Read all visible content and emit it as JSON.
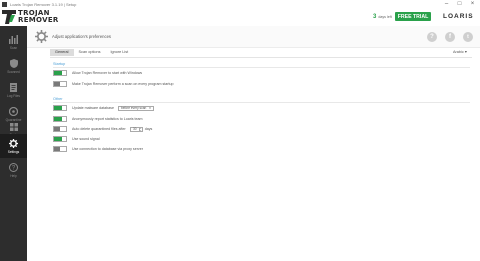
{
  "window": {
    "title": "Loaris Trojan Remover 3.1.19 | Setup"
  },
  "logo": {
    "line1": "TROJAN",
    "line2": "REMOVER"
  },
  "trial": {
    "days": "3",
    "days_left_label": "days left",
    "button": "FREE TRIAL"
  },
  "brand": "LOARIS",
  "header": {
    "subtitle": "Adjust application's preferences",
    "help": "?",
    "settings": "f"
  },
  "sidebar": {
    "items": [
      {
        "label": "Scan",
        "icon": "scan-icon"
      },
      {
        "label": "Scanned",
        "icon": "shield-icon"
      },
      {
        "label": "Log Files",
        "icon": "logfiles-icon"
      },
      {
        "label": "Quarantine",
        "icon": "quarantine-icon"
      },
      {
        "label": "Tools",
        "icon": "tools-icon"
      },
      {
        "label": "Settings",
        "icon": "gear-icon"
      },
      {
        "label": "Help",
        "icon": "help-icon"
      }
    ]
  },
  "tabs": [
    {
      "label": "General"
    },
    {
      "label": "Scan options"
    },
    {
      "label": "Ignore List"
    }
  ],
  "language": "Arabic",
  "sections": {
    "startup": "Startup",
    "other": "Other"
  },
  "options": {
    "startup": [
      {
        "label": "Allow Trojan Remover to start with Windows",
        "state": "on"
      },
      {
        "label": "Make Trojan Remover perform a scan on every program startup",
        "state": "off"
      }
    ],
    "other": [
      {
        "label": "Update malware database",
        "state": "on",
        "select": "before every scan"
      },
      {
        "label": "Anonymously report statistics to Loaris team",
        "state": "on"
      },
      {
        "label": "Auto delete quarantined files after",
        "state": "off",
        "days_value": "30",
        "days_label": "days"
      },
      {
        "label": "Use sound signal",
        "state": "on"
      },
      {
        "label": "Use connection to database via proxy server",
        "state": "off"
      }
    ]
  },
  "colors": {
    "accent": "#2aa14b",
    "section": "#4a9ed6",
    "sidebar": "#2d2d2d"
  }
}
